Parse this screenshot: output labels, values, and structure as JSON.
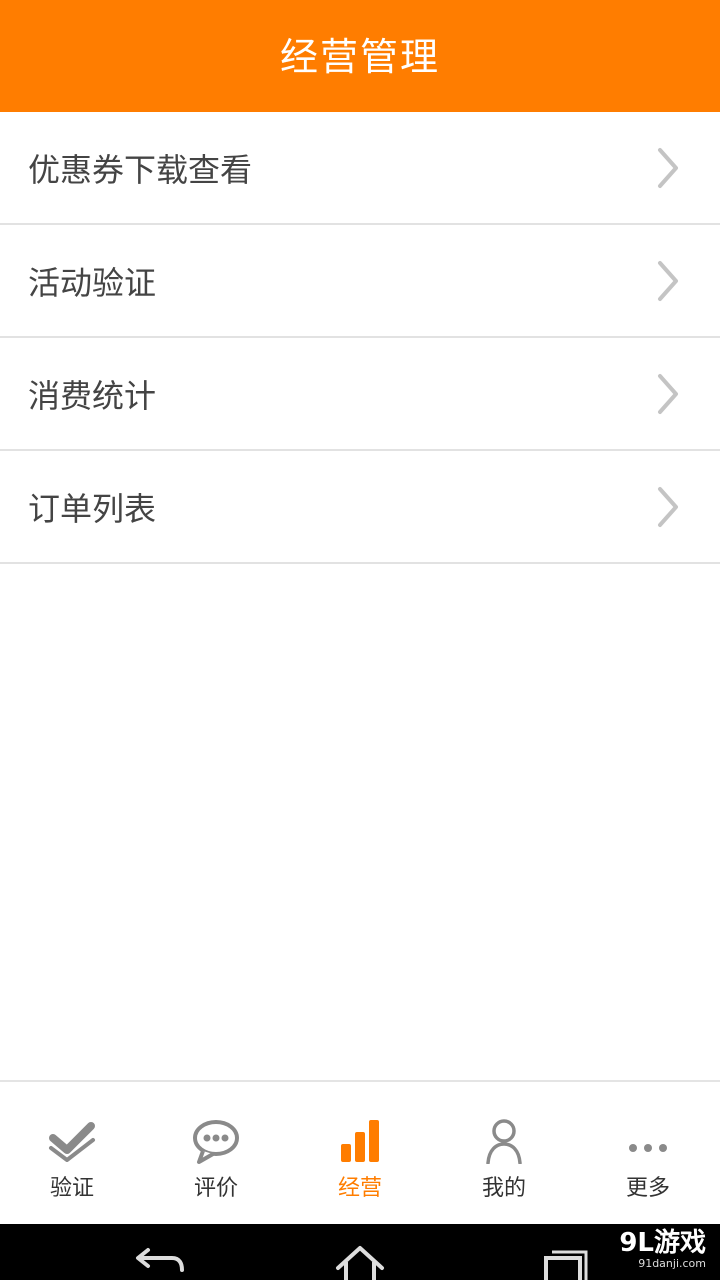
{
  "header": {
    "title": "经营管理"
  },
  "menu": {
    "items": [
      {
        "label": "优惠券下载查看"
      },
      {
        "label": "活动验证"
      },
      {
        "label": "消费统计"
      },
      {
        "label": "订单列表"
      }
    ]
  },
  "tabbar": {
    "items": [
      {
        "label": "验证",
        "icon": "verify-icon",
        "active": false
      },
      {
        "label": "评价",
        "icon": "chat-bubble-icon",
        "active": false
      },
      {
        "label": "经营",
        "icon": "bar-chart-icon",
        "active": true
      },
      {
        "label": "我的",
        "icon": "user-icon",
        "active": false
      },
      {
        "label": "更多",
        "icon": "more-dots-icon",
        "active": false
      }
    ]
  },
  "watermark": {
    "main": "9L游戏",
    "sub": "91danji.com"
  },
  "colors": {
    "accent": "#ff7d00",
    "divider": "#e2e2e2",
    "text": "#444444",
    "icon_gray": "#8a8a8a"
  }
}
